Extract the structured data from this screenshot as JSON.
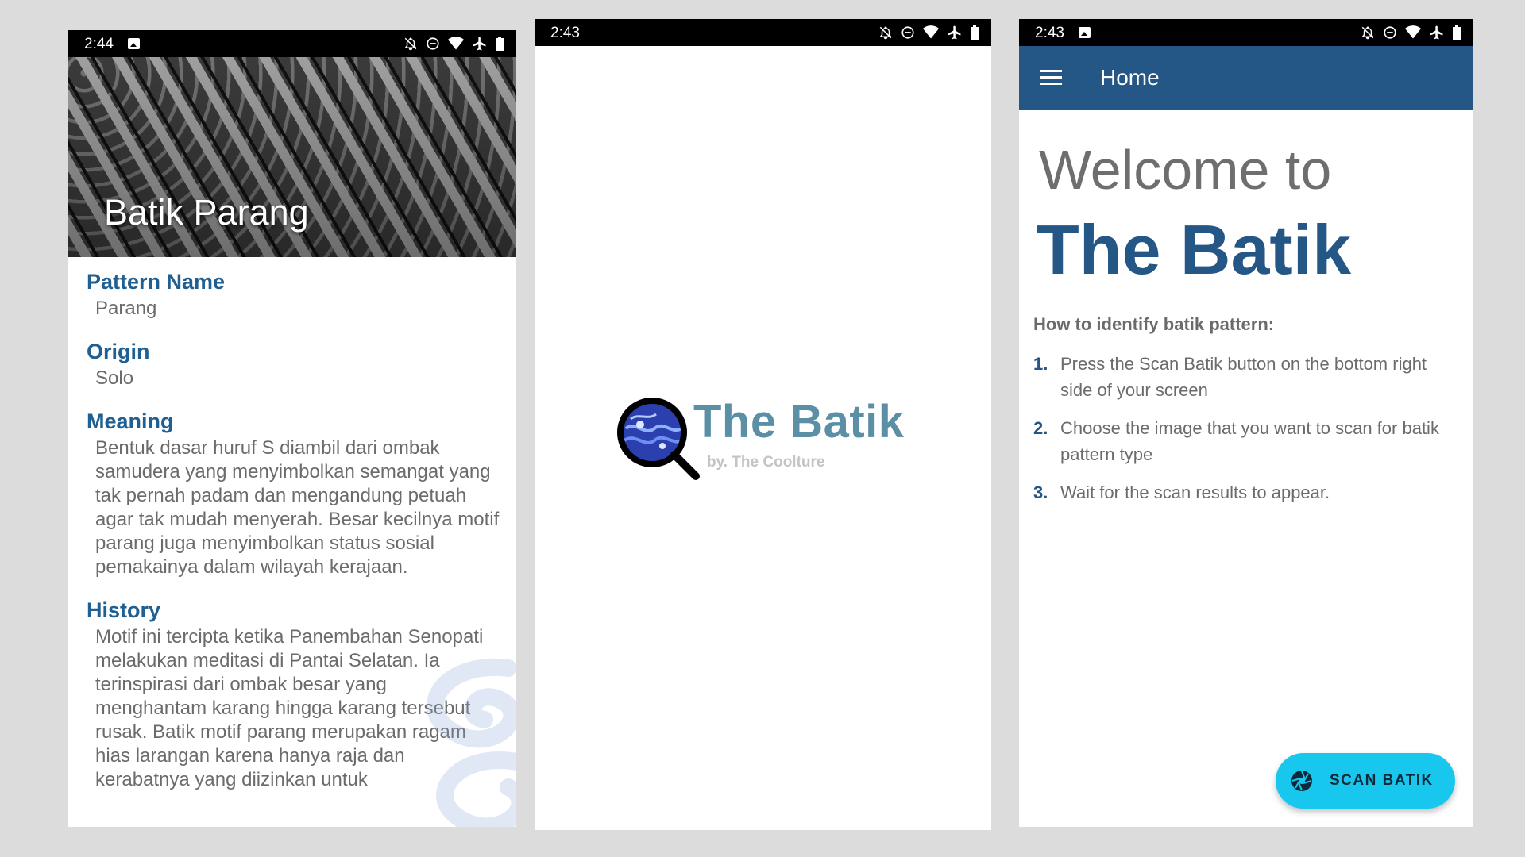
{
  "detail_screen": {
    "status_time": "2:44",
    "hero_title": "Batik Parang",
    "sections": [
      {
        "label": "Pattern Name",
        "value": "Parang"
      },
      {
        "label": "Origin",
        "value": "Solo"
      },
      {
        "label": "Meaning",
        "value": "Bentuk dasar huruf S diambil dari ombak samudera yang menyimbolkan semangat yang tak pernah padam dan mengandung petuah agar tak mudah menyerah. Besar kecilnya motif parang juga menyimbolkan status sosial pemakainya dalam wilayah kerajaan."
      },
      {
        "label": "History",
        "value": "Motif ini tercipta ketika Panembahan Senopati melakukan meditasi di Pantai Selatan. Ia terinspirasi dari ombak besar yang menghantam karang hingga karang tersebut rusak. Batik motif parang merupakan ragam hias larangan karena hanya raja dan kerabatnya yang diizinkan untuk"
      }
    ]
  },
  "splash_screen": {
    "status_time": "2:43",
    "app_name": "The Batik",
    "byline": "by. The Coolture"
  },
  "home_screen": {
    "status_time": "2:43",
    "appbar_title": "Home",
    "welcome": "Welcome to",
    "brand": "The Batik",
    "how_title": "How to identify batik pattern:",
    "steps": [
      {
        "num": "1.",
        "text": "Press the Scan Batik button on the bottom right side of your screen"
      },
      {
        "num": "2.",
        "text": "Choose the image that you want to scan for batik pattern type"
      },
      {
        "num": "3.",
        "text": "Wait for the scan results to appear."
      }
    ],
    "fab_label": "SCAN BATIK"
  },
  "icons": {
    "status_bar": [
      "image-notification-icon",
      "bell-off-icon",
      "do-not-disturb-icon",
      "wifi-icon",
      "airplane-icon",
      "battery-icon"
    ],
    "home": [
      "menu-icon",
      "camera-shutter-icon"
    ]
  },
  "colors": {
    "primary": "#245686",
    "accent": "#17c7ee",
    "splash_title": "#5a8fa6",
    "text_gray": "#6b6b6b"
  }
}
